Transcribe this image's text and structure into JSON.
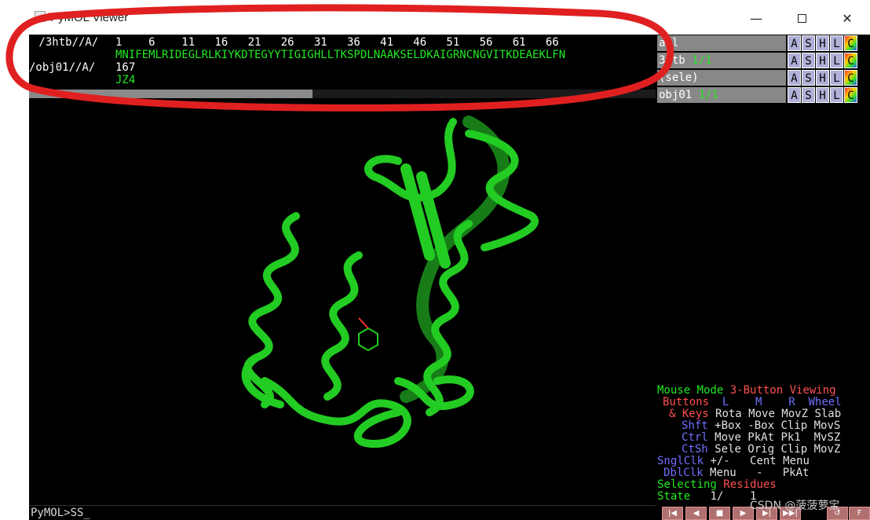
{
  "window": {
    "title": "PyMOL Viewer",
    "minimize_glyph": "—",
    "close_glyph": "✕"
  },
  "sequence": {
    "row1_label": " /3htb//A/",
    "row1_numbers": "1    6    11   16   21   26   31   36   41   46   51   56   61   66",
    "row1_residues": "MNIFEMLRIDEGLRLKIYKDTEGYYTIGIGHLLTKSPDLNAAKSELDKAIGRNCNGVITKDEAEKLFN",
    "row2_label": "/obj01//A/",
    "row2_numbers": "167",
    "row2_residues": "JZ4"
  },
  "command_line": {
    "text": "PyMOL>SS_"
  },
  "objects": [
    {
      "name": "all",
      "state": ""
    },
    {
      "name": "3htb",
      "state": "1/1"
    },
    {
      "name": "(sele)",
      "state": ""
    },
    {
      "name": "obj01",
      "state": "1/1"
    }
  ],
  "object_buttons": {
    "a": "A",
    "s": "S",
    "h": "H",
    "l": "L",
    "c": "C"
  },
  "mouse_mode": {
    "title_label": "Mouse Mode",
    "title_mode": "3-Button Viewing",
    "buttons_label": "Buttons",
    "col_l": "L",
    "col_m": "M",
    "col_r": "R",
    "col_wheel": "Wheel",
    "keys_label": "& Keys",
    "keys_row": "Rota Move MovZ Slab",
    "shft_label": "Shft",
    "shft_row": "+Box -Box Clip MovS",
    "ctrl_label": "Ctrl",
    "ctrl_row": "Move PkAt Pk1  MvSZ",
    "ctsh_label": "CtSh",
    "ctsh_row": "Sele Orig Clip MovZ",
    "sngl_label": "SnglClk",
    "sngl_row": "+/-   Cent Menu",
    "dbl_label": "DblClk",
    "dbl_row": "Menu   -   PkAt",
    "selecting_label": "Selecting",
    "selecting_value": "Residues",
    "state_label": "State",
    "state_value": "1/    1"
  },
  "playback": {
    "buttons": [
      "|◀",
      "◀",
      "■",
      "▶",
      "▶|",
      "▶▶|",
      "↺",
      "F"
    ]
  },
  "watermark": {
    "text": "CSDN @菠菠萝宝"
  },
  "colors": {
    "structure": "#22cc22",
    "residue_text": "#22e822",
    "annotation_circle": "#e02020",
    "ligand_oxygen": "#ff3030"
  }
}
